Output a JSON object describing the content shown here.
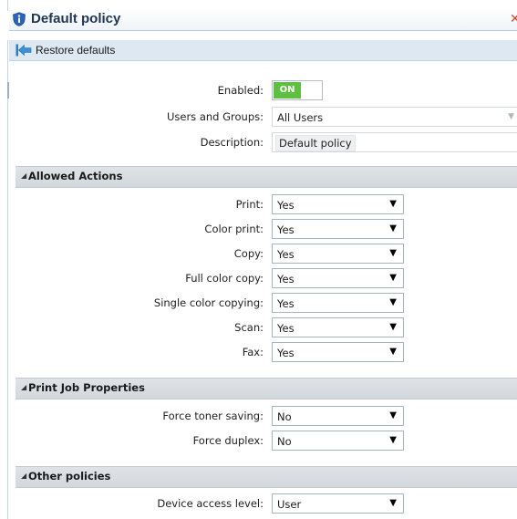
{
  "window": {
    "title": "Default policy"
  },
  "toolbar": {
    "restore_label": "Restore defaults"
  },
  "general": {
    "enabled": {
      "label": "Enabled:",
      "state": "ON",
      "accent": "#5fbf41"
    },
    "users_groups": {
      "label": "Users and Groups:",
      "value": "All Users"
    },
    "description": {
      "label": "Description:",
      "value": "Default policy"
    }
  },
  "sections": {
    "allowed_actions": {
      "title": "Allowed Actions",
      "rows": [
        {
          "label": "Print:",
          "value": "Yes"
        },
        {
          "label": "Color print:",
          "value": "Yes"
        },
        {
          "label": "Copy:",
          "value": "Yes"
        },
        {
          "label": "Full color copy:",
          "value": "Yes"
        },
        {
          "label": "Single color copying:",
          "value": "Yes"
        },
        {
          "label": "Scan:",
          "value": "Yes"
        },
        {
          "label": "Fax:",
          "value": "Yes"
        }
      ]
    },
    "print_job": {
      "title": "Print Job Properties",
      "rows": [
        {
          "label": "Force toner saving:",
          "value": "No"
        },
        {
          "label": "Force duplex:",
          "value": "No"
        }
      ]
    },
    "other": {
      "title": "Other policies",
      "rows": [
        {
          "label": "Device access level:",
          "value": "User"
        }
      ]
    }
  },
  "icons": {
    "title": "shield-info-icon",
    "close": "close-icon",
    "restore": "restore-arrow-icon",
    "caret": "caret-down-icon",
    "collapse": "collapse-triangle-icon"
  }
}
